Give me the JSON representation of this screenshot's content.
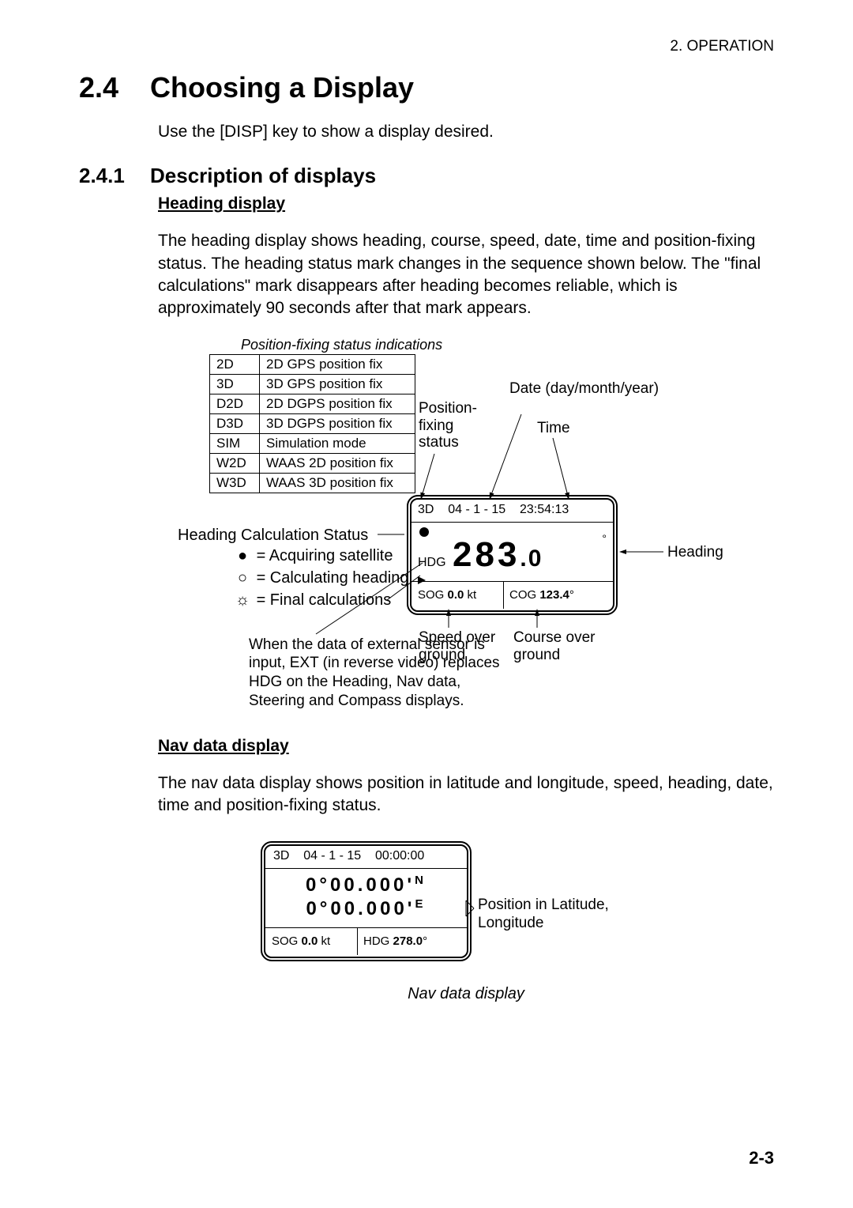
{
  "header": {
    "chapter": "2. OPERATION"
  },
  "section": {
    "num": "2.4",
    "title": "Choosing a Display",
    "intro": "Use the [DISP] key to show a display desired."
  },
  "sub": {
    "num": "2.4.1",
    "title": "Description of displays"
  },
  "heading_disp": {
    "run": "Heading display",
    "para": "The heading display shows heading, course, speed, date, time and position-fixing status. The heading status mark changes in the sequence shown below. The \"final calculations\" mark disappears after heading becomes reliable, which is approximately 90 seconds after that mark appears."
  },
  "status_table": {
    "caption": "Position-fixing status indications",
    "rows": [
      {
        "code": "2D",
        "desc": "2D GPS position fix"
      },
      {
        "code": "3D",
        "desc": "3D GPS position fix"
      },
      {
        "code": "D2D",
        "desc": "2D DGPS position fix"
      },
      {
        "code": "D3D",
        "desc": "3D DGPS position fix"
      },
      {
        "code": "SIM",
        "desc": "Simulation mode"
      },
      {
        "code": "W2D",
        "desc": "WAAS 2D position fix"
      },
      {
        "code": "W3D",
        "desc": "WAAS 3D position fix"
      }
    ]
  },
  "hcs": {
    "title": "Heading Calculation Status",
    "items": [
      {
        "glyph": "●",
        "label": "= Acquiring satellite"
      },
      {
        "glyph": "○",
        "label": "= Calculating heading"
      },
      {
        "glyph": "☼",
        "label": "= Final calculations"
      }
    ]
  },
  "ext_note": "When the data of external sensor is input, EXT (in reverse video) replaces HDG on the Heading, Nav data, Steering and Compass displays.",
  "callouts": {
    "date": "Date (day/month/year)",
    "time": "Time",
    "posfix": "Position- fixing status",
    "heading": "Heading",
    "sog": "Speed over ground",
    "cog": "Course over ground",
    "posll": "Position in Latitude, Longitude"
  },
  "screen1": {
    "fix": "3D",
    "date": "04 - 1 - 15",
    "time": "23:54:13",
    "hdg_lbl": "HDG",
    "hdg_val": "283",
    "hdg_dec": ".0",
    "deg": "°",
    "sog_lbl": "SOG",
    "sog_val": "0.0",
    "sog_unit": "kt",
    "cog_lbl": "COG",
    "cog_val": "123.4",
    "cog_deg": "°"
  },
  "nav_disp": {
    "run": "Nav data display",
    "para": "The nav data display shows position in latitude and longitude, speed, heading, date, time and position-fixing status.",
    "caption": "Nav data display"
  },
  "screen2": {
    "fix": "3D",
    "date": "04 - 1 - 15",
    "time": "00:00:00",
    "lat": "0°00.000'",
    "lat_hemi": "N",
    "lon": "0°00.000'",
    "lon_hemi": "E",
    "sog_lbl": "SOG",
    "sog_val": "0.0",
    "sog_unit": "kt",
    "hdg_lbl": "HDG",
    "hdg_val": "278.0",
    "hdg_deg": "°"
  },
  "pagenum": "2-3"
}
